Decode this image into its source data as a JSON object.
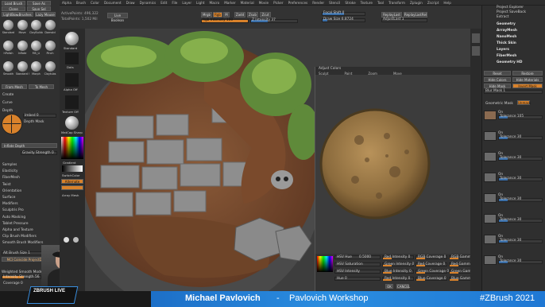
{
  "menu": {
    "items": [
      "Alpha",
      "Brush",
      "Color",
      "Document",
      "Draw",
      "Dynamics",
      "Edit",
      "File",
      "Layer",
      "Light",
      "Macro",
      "Marker",
      "Material",
      "Movie",
      "Picker",
      "Preferences",
      "Render",
      "Stencil",
      "Stroke",
      "Texture",
      "Tool",
      "Transform",
      "Zplugin",
      "Zscript",
      "Help"
    ]
  },
  "top_info": {
    "active_points": "ActivePoints: 496,322",
    "total_points": "TotalPoints: 1,502 Mil",
    "live_boolean": "Live Boolean",
    "mrgb": "Mrgb",
    "rgb": "Rgb",
    "m": "M",
    "zadd": "Zadd",
    "zsub": "Zsub",
    "zcut": "Zcut",
    "focal_shift": "Focal Shift 0",
    "draw_size": "Draw Size 6.8724",
    "rgb_intensity": "Rgb Intensity 100",
    "z_intensity": "Z Intensity 37",
    "replay_last": "ReplayLast",
    "replay_last_rel": "ReplayLastRel",
    "adjust_last": "AdjustLast 1"
  },
  "left_panel": {
    "top_buttons": [
      "Load Brush",
      "Save As",
      "Clone",
      "Save Sel",
      "LightBox▸Brushes",
      "Lazy Mouse"
    ],
    "brush_names": [
      "Standard",
      "Move",
      "ClayBuildup",
      "Damstd",
      "hPolish",
      "Inflate",
      "MS_Li",
      "Pinch",
      "Smooth",
      "Standard Smooth",
      "Morph",
      "Claytubs"
    ],
    "buttons2": [
      "From Mesh",
      "To Mesh"
    ],
    "sections": [
      "Create",
      "Curve",
      "Depth"
    ],
    "imbed": "Imbed 0",
    "depth_mask": "Depth Mask",
    "inflate_depth": "Inflate Depth",
    "gravity": "Gravity Strength 0",
    "subsections": [
      "Samples",
      "Elasticity",
      "FiberMesh",
      "Twist",
      "Orientation",
      "Surface",
      "Modifiers",
      "Sculptris Pro",
      "Auto Masking",
      "Tablet Pressure",
      "Alpha and Texture",
      "Clip Brush Modifiers",
      "Smooth Brush Modifiers"
    ],
    "alt_brush_size": "Alt Brush Size 1",
    "mc_label": "MCI Coincide ProjectDraggin",
    "weighted_smooth": "Weighted Smooth Mode 0",
    "intensity": "Intensity Strength 56",
    "coverage": "Coverage 0"
  },
  "mid_shelf": {
    "labels": [
      "Standard",
      "Dots",
      "Alpha Off",
      "Texture Off",
      "MatCap Sharp",
      "Gradient",
      "SwitchColor",
      "Alternate",
      "Array Mesh"
    ]
  },
  "canvas": {
    "subwindow": {
      "title": "Adjust Colors",
      "tabs": [
        "Sculpt",
        "Paint",
        "Zoom",
        "Move"
      ],
      "hsv": [
        {
          "label": "HSV Hue",
          "value": "0.5000"
        },
        {
          "label": "HSV Saturation",
          "value": ""
        },
        {
          "label": "HSV Intensity",
          "value": ""
        },
        {
          "label": "Hue 0",
          "value": ""
        }
      ],
      "rgb_sliders": [
        "Red Intensity 0",
        "Green Intensity 0",
        "Blue Intensity 0",
        "Red Intensity 0"
      ],
      "rgb_coverage": [
        "RGB Coverage 0",
        "Red Coverage 0",
        "Green Coverage 0",
        "Blue Coverage 0"
      ],
      "gamma": [
        "RGB Gamma 1",
        "Red Gamma 1",
        "Green Gamma 1",
        "Blue Gamma 1"
      ],
      "ok": "OK",
      "cancel": "CANCEL"
    }
  },
  "right_panel": {
    "top": [
      "Project Explorer",
      "Project SaveBack",
      "Extract"
    ],
    "sections": [
      "Geometry",
      "ArrayMesh",
      "NanoMesh",
      "Thick Skin",
      "Layers",
      "FiberMesh",
      "Geometry HD"
    ],
    "reset": "Reset",
    "restore": "Restore",
    "hide_colors": "Hide Colors",
    "hide_materials": "Hide Materials",
    "hide_mask": "Hide Mask",
    "invert_mask": "Invert Mask",
    "blur_mask": "Blur Mask 1",
    "geometric_mask": "Geometric Mask",
    "unmask": "Unmask",
    "rows": [
      {
        "on": "On",
        "tol": "Tolerance 105"
      },
      {
        "on": "On",
        "tol": "Tolerance 30"
      },
      {
        "on": "On",
        "tol": "Tolerance 30"
      },
      {
        "on": "On",
        "tol": "Tolerance 30"
      },
      {
        "on": "On",
        "tol": "Tolerance 30"
      },
      {
        "on": "On",
        "tol": "Tolerance 30"
      },
      {
        "on": "On",
        "tol": "Tolerance 30"
      },
      {
        "on": "On",
        "tol": "Tolerance 30"
      }
    ]
  },
  "bottom": {
    "presenter": "Michael Pavlovich",
    "separator": "-",
    "workshop": "Pavlovich Workshop",
    "hashtag": "#ZBrush 2021",
    "logo": "ZBRUSH LIVE"
  },
  "colors": {
    "accent": "#d9822b",
    "banner_blue": "#2a8de0",
    "background": "#2a2a2a"
  }
}
